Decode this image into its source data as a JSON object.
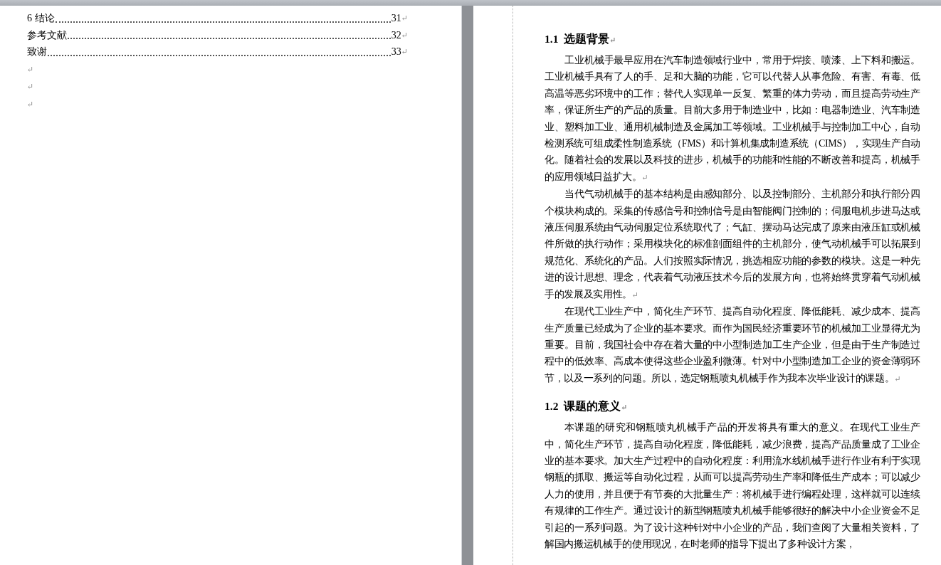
{
  "left_page": {
    "toc": [
      {
        "title": "6  结论",
        "page": "31",
        "mark": "↵"
      },
      {
        "title": "参考文献",
        "page": "32",
        "mark": "↵"
      },
      {
        "title": "致谢",
        "page": "33",
        "mark": "↵"
      }
    ],
    "empty_paragraphs": [
      "↵",
      "↵",
      "↵"
    ]
  },
  "right_page": {
    "blocks": [
      {
        "kind": "heading",
        "number": "1.1",
        "text": "选题背景",
        "mark": "↵"
      },
      {
        "kind": "paragraph",
        "text": "工业机械手最早应用在汽车制造领域行业中，常用于焊接、喷漆、上下料和搬运。工业机械手具有了人的手、足和大脑的功能，它可以代替人从事危险、有害、有毒、低高温等恶劣环境中的工作；替代人实现单一反复、繁重的体力劳动，而且提高劳动生产率，保证所生产的产品的质量。目前大多用于制造业中，比如：电器制造业、汽车制造业、塑料加工业、通用机械制造及金属加工等领域。工业机械手与控制加工中心，自动检测系统可组成柔性制造系统（FMS）和计算机集成制造系统（CIMS），实现生产自动化。随着社会的发展以及科技的进步，机械手的功能和性能的不断改善和提高，机械手的应用领域日益扩大。",
        "mark": "↵"
      },
      {
        "kind": "paragraph",
        "text": "当代气动机械手的基本结构是由感知部分、以及控制部分、主机部分和执行部分四个模块构成的。采集的传感信号和控制信号是由智能阀门控制的；伺服电机步进马达或液压伺服系统由气动伺服定位系统取代了；气缸、摆动马达完成了原来由液压缸或机械件所做的执行动作；采用模块化的标准剖面组件的主机部分，使气动机械手可以拓展到规范化、系统化的产品。人们按照实际情况，挑选相应功能的参数的模块。这是一种先进的设计思想、理念，代表着气动液压技术今后的发展方向，也将始终贯穿着气动机械手的发展及实用性。",
        "mark": "↵"
      },
      {
        "kind": "paragraph",
        "text": "在现代工业生产中，简化生产环节、提高自动化程度、降低能耗、减少成本、提高生产质量已经成为了企业的基本要求。而作为国民经济重要环节的机械加工业显得尤为重要。目前，我国社会中存在着大量的中小型制造加工生产企业，但是由于生产制造过程中的低效率、高成本使得这些企业盈利微薄。针对中小型制造加工企业的资金薄弱环节，以及一系列的问题。所以，选定钢瓶喷丸机械手作为我本次毕业设计的课题。",
        "mark": "↵"
      },
      {
        "kind": "heading",
        "number": "1.2",
        "text": "课题的意义",
        "mark": "↵"
      },
      {
        "kind": "paragraph",
        "text": "本课题的研究和钢瓶喷丸机械手产品的开发将具有重大的意义。在现代工业生产中，简化生产环节，提高自动化程度，降低能耗，减少浪费，提高产品质量成了工业企业的基本要求。加大生产过程中的自动化程度：利用流水线机械手进行作业有利于实现钢瓶的抓取、搬运等自动化过程，从而可以提高劳动生产率和降低生产成本；可以减少人力的使用，并且便于有节奏的大批量生产：将机械手进行编程处理，这样就可以连续有规律的工作生产。通过设计的新型钢瓶喷丸机械手能够很好的解决中小企业资金不足引起的一系列问题。为了设计这种针对中小企业的产品，我们查阅了大量相关资料，了解国内搬运机械手的使用现况，在时老师的指导下提出了多种设计方案，"
      }
    ]
  }
}
